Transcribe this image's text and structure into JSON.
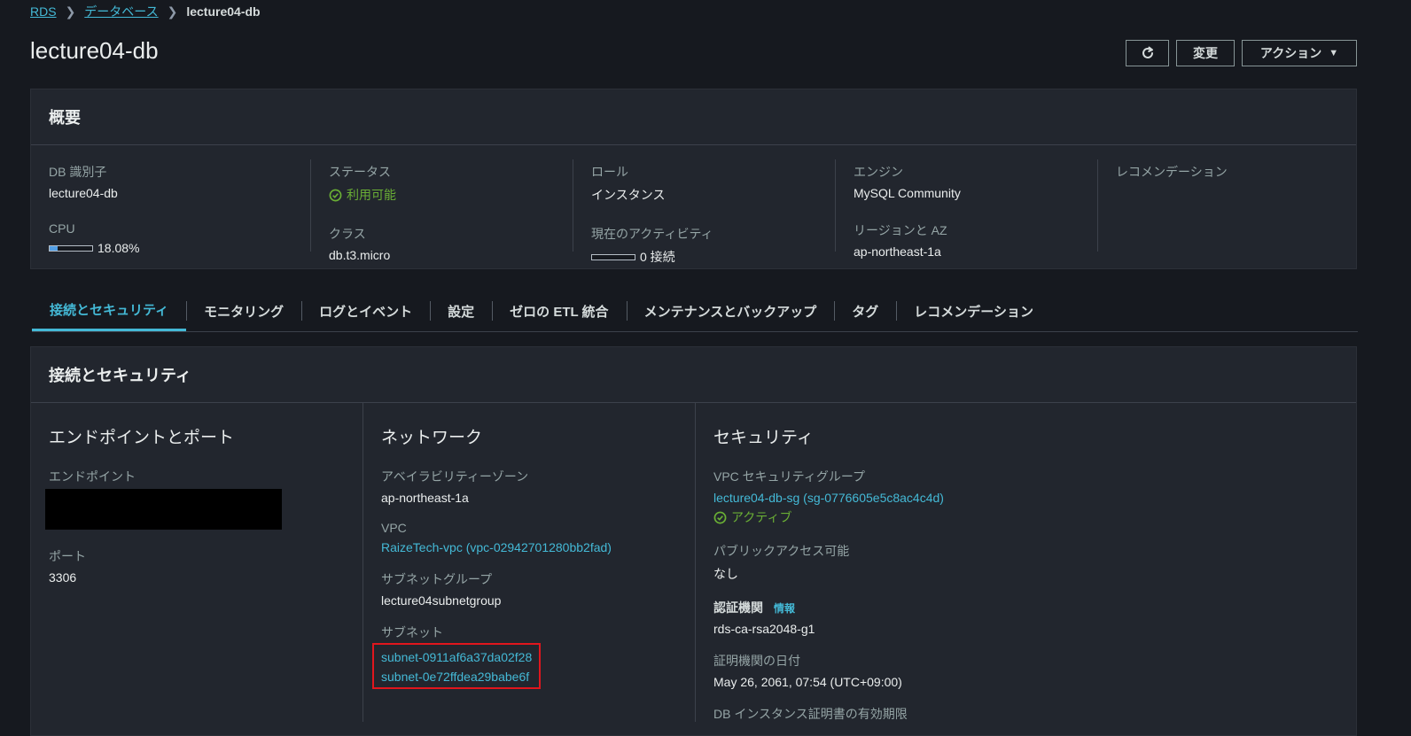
{
  "breadcrumb": {
    "root": "RDS",
    "databases": "データベース",
    "current": "lecture04-db"
  },
  "page_title": "lecture04-db",
  "header_buttons": {
    "modify": "変更",
    "actions": "アクション"
  },
  "summary": {
    "title": "概要",
    "db_identifier_label": "DB 識別子",
    "db_identifier": "lecture04-db",
    "cpu_label": "CPU",
    "cpu_value": "18.08%",
    "cpu_percent": 18.08,
    "status_label": "ステータス",
    "status": "利用可能",
    "class_label": "クラス",
    "class": "db.t3.micro",
    "role_label": "ロール",
    "role": "インスタンス",
    "activity_label": "現在のアクティビティ",
    "activity": "0 接続",
    "activity_percent": 0,
    "engine_label": "エンジン",
    "engine": "MySQL Community",
    "region_label": "リージョンと AZ",
    "region": "ap-northeast-1a",
    "recommendation_label": "レコメンデーション"
  },
  "tabs": [
    {
      "label": "接続とセキュリティ",
      "active": true
    },
    {
      "label": "モニタリング"
    },
    {
      "label": "ログとイベント"
    },
    {
      "label": "設定"
    },
    {
      "label": "ゼロの ETL 統合"
    },
    {
      "label": "メンテナンスとバックアップ"
    },
    {
      "label": "タグ"
    },
    {
      "label": "レコメンデーション"
    }
  ],
  "conn_security": {
    "title": "接続とセキュリティ",
    "endpoint_section": {
      "heading": "エンドポイントとポート",
      "endpoint_label": "エンドポイント",
      "port_label": "ポート",
      "port": "3306"
    },
    "network_section": {
      "heading": "ネットワーク",
      "az_label": "アベイラビリティーゾーン",
      "az": "ap-northeast-1a",
      "vpc_label": "VPC",
      "vpc": "RaizeTech-vpc (vpc-02942701280bb2fad)",
      "subnet_group_label": "サブネットグループ",
      "subnet_group": "lecture04subnetgroup",
      "subnets_label": "サブネット",
      "subnets": [
        "subnet-0911af6a37da02f28",
        "subnet-0e72ffdea29babe6f"
      ]
    },
    "security_section": {
      "heading": "セキュリティ",
      "sg_label": "VPC セキュリティグループ",
      "sg": "lecture04-db-sg (sg-0776605e5c8ac4c4d)",
      "sg_status": "アクティブ",
      "public_label": "パブリックアクセス可能",
      "public": "なし",
      "ca_label": "認証機関",
      "ca_info": "情報",
      "ca": "rds-ca-rsa2048-g1",
      "ca_date_label": "証明機関の日付",
      "ca_date": "May 26, 2061, 07:54 (UTC+09:00)",
      "cert_expiry_label": "DB インスタンス証明書の有効期限"
    }
  },
  "colors": {
    "accent": "#44b9d6",
    "success": "#6aaf35",
    "highlight": "#e0161d",
    "bg": "#16191f"
  }
}
